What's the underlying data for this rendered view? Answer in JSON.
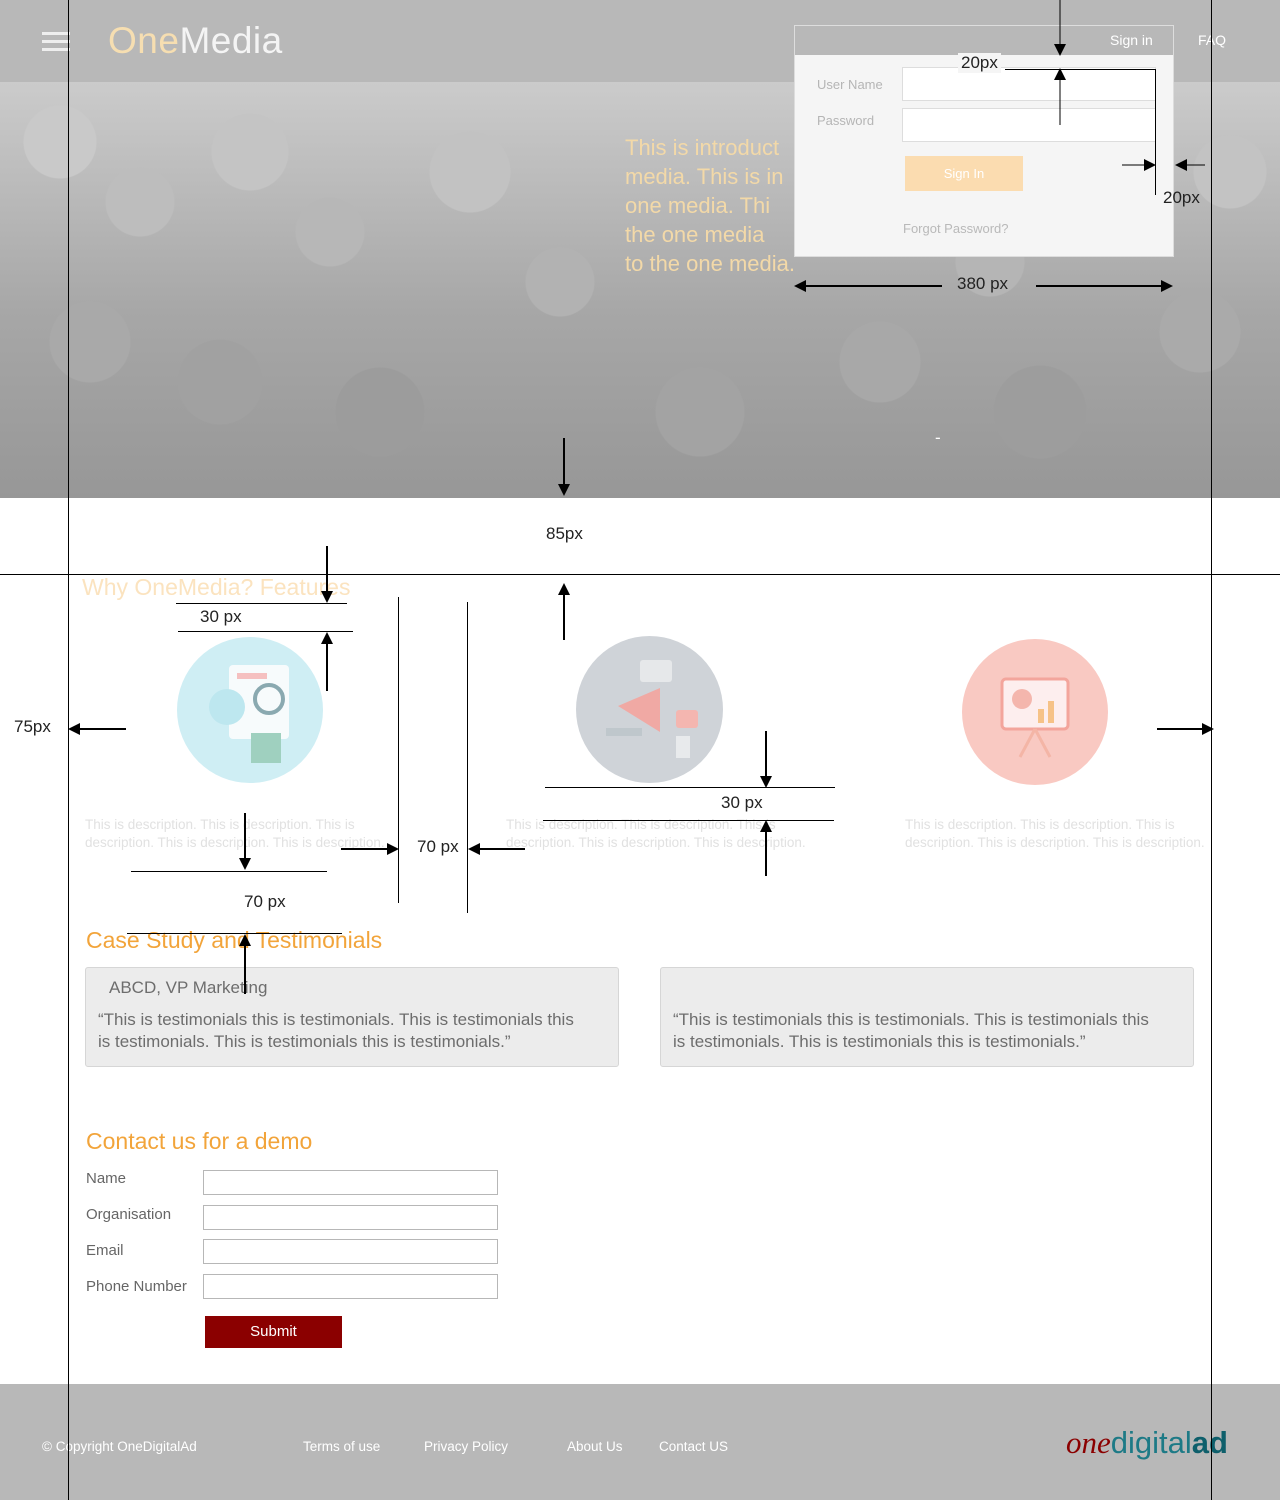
{
  "header": {
    "logo_one": "One",
    "logo_media": "Media",
    "nav_signin": "Sign in",
    "nav_faq": "FAQ"
  },
  "hero": {
    "intro_lines": [
      "This is introduct",
      "media. This is in",
      "one media. Thi",
      "the one media",
      "to the one media."
    ]
  },
  "signin": {
    "username_label": "User Name",
    "password_label": "Password",
    "button": "Sign In",
    "forgot": "Forgot Password?"
  },
  "annotations": {
    "a1": "20px",
    "a2": "20px",
    "a3": "380 px",
    "a4": "85px",
    "a5": "30 px",
    "a6": "75px",
    "a7": "30 px",
    "a8": "70 px",
    "a9": "70 px",
    "dash": "-"
  },
  "features": {
    "title": "Why OneMedia? Features",
    "items": [
      {
        "desc": "This is description. This is description. This is description. This is description. This is description.",
        "color": "#cfeef4"
      },
      {
        "desc": "This is description. This is description. This is description. This is description. This is description.",
        "color": "#cfd3d8"
      },
      {
        "desc": "This is description. This is description. This is description. This is description. This is description.",
        "color": "#f9c9c2"
      }
    ]
  },
  "testimonials": {
    "title": "Case Study and Testimonials",
    "items": [
      {
        "author": "ABCD, VP Marketing",
        "quote_line1": "“This is testimonials this is testimonials. This is testimonials this",
        "quote_line2": "is testimonials. This is testimonials this is testimonials.”"
      },
      {
        "author": "",
        "quote_line1": "“This is testimonials this is testimonials. This is testimonials this",
        "quote_line2": "is testimonials. This is testimonials this is testimonials.”"
      }
    ]
  },
  "contact": {
    "title": "Contact us for a demo",
    "name_label": "Name",
    "org_label": "Organisation",
    "email_label": "Email",
    "phone_label": "Phone Number",
    "submit": "Submit"
  },
  "footer": {
    "copyright": "© Copyright OneDigitalAd",
    "terms": "Terms of use",
    "privacy": "Privacy Policy",
    "about": "About Us",
    "contact": "Contact US",
    "brand_one": "one",
    "brand_digital": "digital",
    "brand_ad": "ad"
  },
  "colors": {
    "accent_orange": "#f2a43a",
    "submit_red": "#8b0000",
    "header_gray": "#b8b8b8"
  }
}
